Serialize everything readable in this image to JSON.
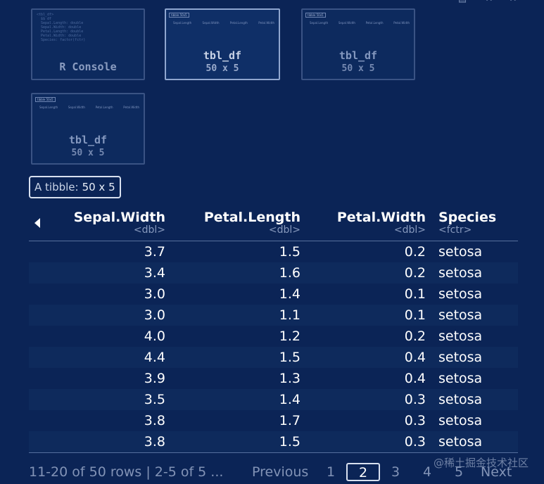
{
  "thumbnails": [
    {
      "title": "R Console",
      "subtitle": "",
      "mini_text": "<tbl_df>\n  $$ df\n  Sepal.Length: double\n  Sepal.Width: double\n  Petal.Length: double\n  Petal.Width: double\n  Species: factor(fctr)"
    },
    {
      "title": "tbl_df",
      "subtitle": "50 x 5",
      "mini_badge": "tibble 50x5",
      "mini_cols": [
        "Sepal.Length",
        "Sepal.Width",
        "Petal.Length",
        "Petal.Width"
      ]
    },
    {
      "title": "tbl_df",
      "subtitle": "50 x 5",
      "mini_badge": "tibble 50x5",
      "mini_cols": [
        "Sepal.Length",
        "Sepal.Width",
        "Petal.Length",
        "Petal.Width"
      ]
    },
    {
      "title": "tbl_df",
      "subtitle": "50 x 5",
      "mini_badge": "tibble 50x5",
      "mini_cols": [
        "Sepal.Length",
        "Sepal.Width",
        "Petal.Length",
        "Petal.Width"
      ]
    }
  ],
  "badge": {
    "prefix": "A tibble:",
    "dims": "50 x 5"
  },
  "columns": [
    {
      "name": "Sepal.Width",
      "type": "<dbl>"
    },
    {
      "name": "Petal.Length",
      "type": "<dbl>"
    },
    {
      "name": "Petal.Width",
      "type": "<dbl>"
    },
    {
      "name": "Species",
      "type": "<fctr>"
    }
  ],
  "rows": [
    [
      "3.7",
      "1.5",
      "0.2",
      "setosa"
    ],
    [
      "3.4",
      "1.6",
      "0.2",
      "setosa"
    ],
    [
      "3.0",
      "1.4",
      "0.1",
      "setosa"
    ],
    [
      "3.0",
      "1.1",
      "0.1",
      "setosa"
    ],
    [
      "4.0",
      "1.2",
      "0.2",
      "setosa"
    ],
    [
      "4.4",
      "1.5",
      "0.4",
      "setosa"
    ],
    [
      "3.9",
      "1.3",
      "0.4",
      "setosa"
    ],
    [
      "3.5",
      "1.4",
      "0.3",
      "setosa"
    ],
    [
      "3.8",
      "1.7",
      "0.3",
      "setosa"
    ],
    [
      "3.8",
      "1.5",
      "0.3",
      "setosa"
    ]
  ],
  "footer": {
    "info": "11-20 of 50 rows | 2-5 of 5 ...",
    "previous": "Previous",
    "pages": [
      "1",
      "2",
      "3",
      "4",
      "5"
    ],
    "current_page": "2",
    "next": "Next"
  },
  "watermark": "@稀土掘金技术社区",
  "colors": {
    "background": "#0b2456",
    "row_alt": "#0e2a5c",
    "muted_text": "#8293b6"
  }
}
